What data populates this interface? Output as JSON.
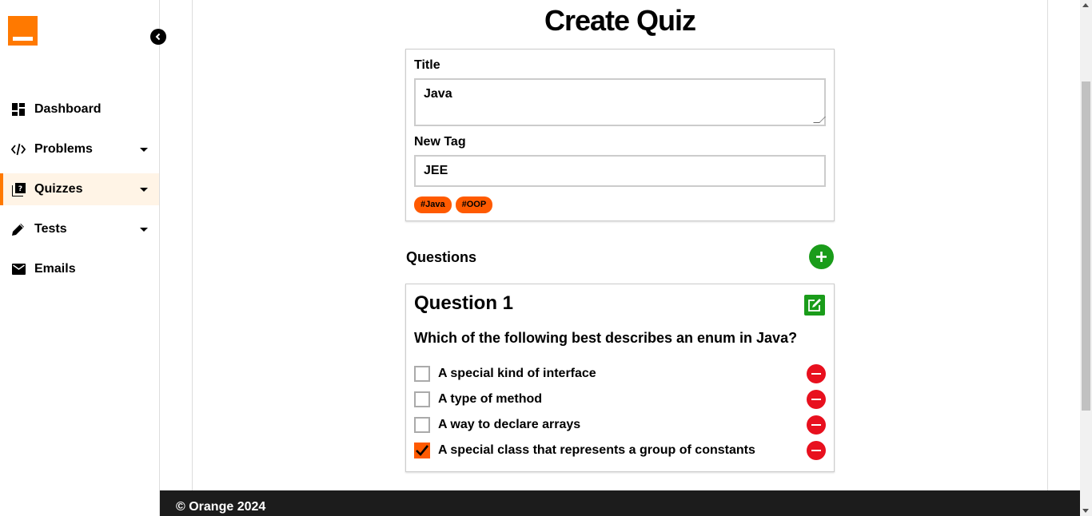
{
  "sidebar": {
    "logo": "orange-logo",
    "collapse_icon": "chevron-left-icon",
    "items": [
      {
        "label": "Dashboard",
        "icon": "dashboard-icon",
        "has_caret": false,
        "active": false
      },
      {
        "label": "Problems",
        "icon": "code-icon",
        "has_caret": true,
        "active": false
      },
      {
        "label": "Quizzes",
        "icon": "quiz-icon",
        "has_caret": true,
        "active": true
      },
      {
        "label": "Tests",
        "icon": "pencil-icon",
        "has_caret": true,
        "active": false
      },
      {
        "label": "Emails",
        "icon": "mail-icon",
        "has_caret": false,
        "active": false
      }
    ]
  },
  "page": {
    "title": "Create Quiz"
  },
  "form": {
    "title_label": "Title",
    "title_value": "Java",
    "tag_label": "New Tag",
    "tag_value": "JEE",
    "tags": [
      "#Java",
      "#OOP"
    ]
  },
  "questions": {
    "heading": "Questions",
    "add_icon": "plus-icon",
    "items": [
      {
        "title": "Question 1",
        "text": "Which of the following best describes an enum in Java?",
        "edit_icon": "edit-icon",
        "options": [
          {
            "text": "A special kind of interface",
            "checked": false
          },
          {
            "text": "A type of method",
            "checked": false
          },
          {
            "text": "A way to declare arrays",
            "checked": false
          },
          {
            "text": "A special class that represents a group of constants",
            "checked": true
          }
        ]
      }
    ]
  },
  "footer": {
    "text": "© Orange 2024"
  },
  "colors": {
    "brand": "#ff7900",
    "tag": "#ff5a00",
    "add": "#1a9c1a",
    "remove": "#e8101e",
    "footer_bg": "#1c1c1c"
  }
}
